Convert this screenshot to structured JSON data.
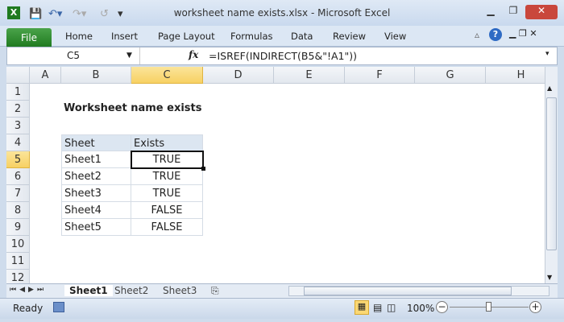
{
  "window": {
    "title": "worksheet name exists.xlsx - Microsoft Excel"
  },
  "ribbon": {
    "tabs": [
      "File",
      "Home",
      "Insert",
      "Page Layout",
      "Formulas",
      "Data",
      "Review",
      "View"
    ]
  },
  "formula_bar": {
    "name_box": "C5",
    "fx": "fx",
    "formula": "=ISREF(INDIRECT(B5&\"!A1\"))"
  },
  "columns": [
    "A",
    "B",
    "C",
    "D",
    "E",
    "F",
    "G",
    "H"
  ],
  "rows": [
    "1",
    "2",
    "3",
    "4",
    "5",
    "6",
    "7",
    "8",
    "9",
    "10",
    "11",
    "12"
  ],
  "sheet": {
    "title": "Worksheet name exists",
    "headers": [
      "Sheet",
      "Exists"
    ],
    "data": [
      [
        "Sheet1",
        "TRUE"
      ],
      [
        "Sheet2",
        "TRUE"
      ],
      [
        "Sheet3",
        "TRUE"
      ],
      [
        "Sheet4",
        "FALSE"
      ],
      [
        "Sheet5",
        "FALSE"
      ]
    ]
  },
  "sheet_tabs": [
    "Sheet1",
    "Sheet2",
    "Sheet3"
  ],
  "status": {
    "ready": "Ready",
    "zoom": "100%"
  }
}
